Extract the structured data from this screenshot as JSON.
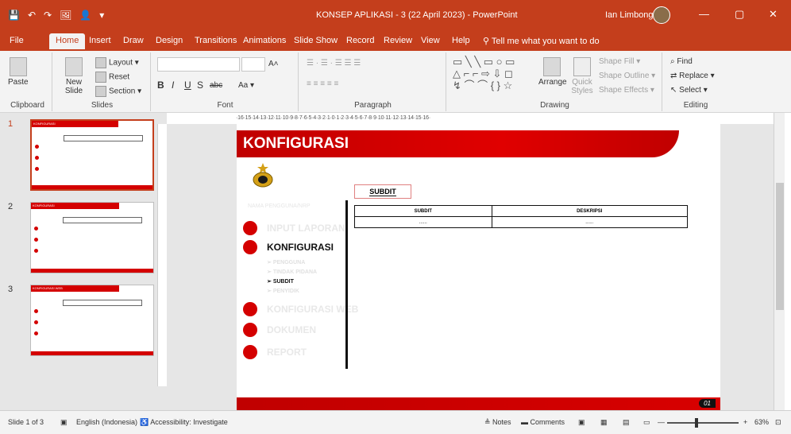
{
  "titlebar": {
    "quick_access": [
      "💾",
      "↶",
      "↷",
      "🖼",
      "👤",
      "▾"
    ],
    "title": "KONSEP APLIKASI - 3 (22 April 2023)  -  PowerPoint",
    "user": "Ian Limbong",
    "min": "—",
    "restore": "▢",
    "close": "✕"
  },
  "tabs": [
    "File",
    "Home",
    "Insert",
    "Draw",
    "Design",
    "Transitions",
    "Animations",
    "Slide Show",
    "Record",
    "Review",
    "View",
    "Help"
  ],
  "tell_me": "Tell me what you want to do",
  "ribbon": {
    "clipboard": {
      "paste": "Paste",
      "label": "Clipboard"
    },
    "slides": {
      "new_slide": "New Slide",
      "layout": "Layout ▾",
      "reset": "Reset",
      "section": "Section ▾",
      "label": "Slides"
    },
    "font": {
      "bold": "B",
      "italic": "I",
      "underline": "U",
      "shadow": "S",
      "strike": "abc",
      "grow": "A˄",
      "shrink": "A˅",
      "case": "Aa ▾",
      "label": "Font"
    },
    "paragraph": {
      "label": "Paragraph"
    },
    "drawing": {
      "arrange": "Arrange",
      "quick_styles": "Quick Styles",
      "shape_fill": "Shape Fill ▾",
      "shape_outline": "Shape Outline ▾",
      "shape_effects": "Shape Effects ▾",
      "label": "Drawing"
    },
    "editing": {
      "find": "Find",
      "replace": "Replace ▾",
      "select": "Select ▾",
      "label": "Editing"
    }
  },
  "thumbnails": [
    {
      "num": "1",
      "title": "KONFIGURASI"
    },
    {
      "num": "2",
      "title": "KONFIGURASI"
    },
    {
      "num": "3",
      "title": "KONFIGURASI WEB"
    }
  ],
  "ruler_text": "·16·15·14·13·12·11·10·9·8·7·6·5·4·3·2·1·0·1·2·3·4·5·6·7·8·9·10·11·12·13·14·15·16·",
  "slide": {
    "title": "KONFIGURASI",
    "nama": "NAMA PENGGUNA/NRP",
    "menu": [
      {
        "label": "INPUT LAPORAN"
      },
      {
        "label": "KONFIGURASI"
      },
      {
        "label": "KONFIGURASI WEB"
      },
      {
        "label": "DOKUMEN"
      },
      {
        "label": "REPORT"
      }
    ],
    "submenu": [
      "PENGGUNA",
      "TINDAK PIDANA",
      "SUBDIT",
      "PENYIDIK"
    ],
    "sub_arrow": "➢",
    "subdit_label": "SUBDIT",
    "table_headers": [
      "SUBDIT",
      "DESKRIPSI"
    ],
    "table_row": [
      "......",
      "......"
    ],
    "page": "01"
  },
  "status": {
    "slide_of": "Slide 1 of 3",
    "language": "English (Indonesia)",
    "accessibility": "Accessibility: Investigate",
    "notes": "Notes",
    "comments": "Comments",
    "zoom": "63%"
  }
}
